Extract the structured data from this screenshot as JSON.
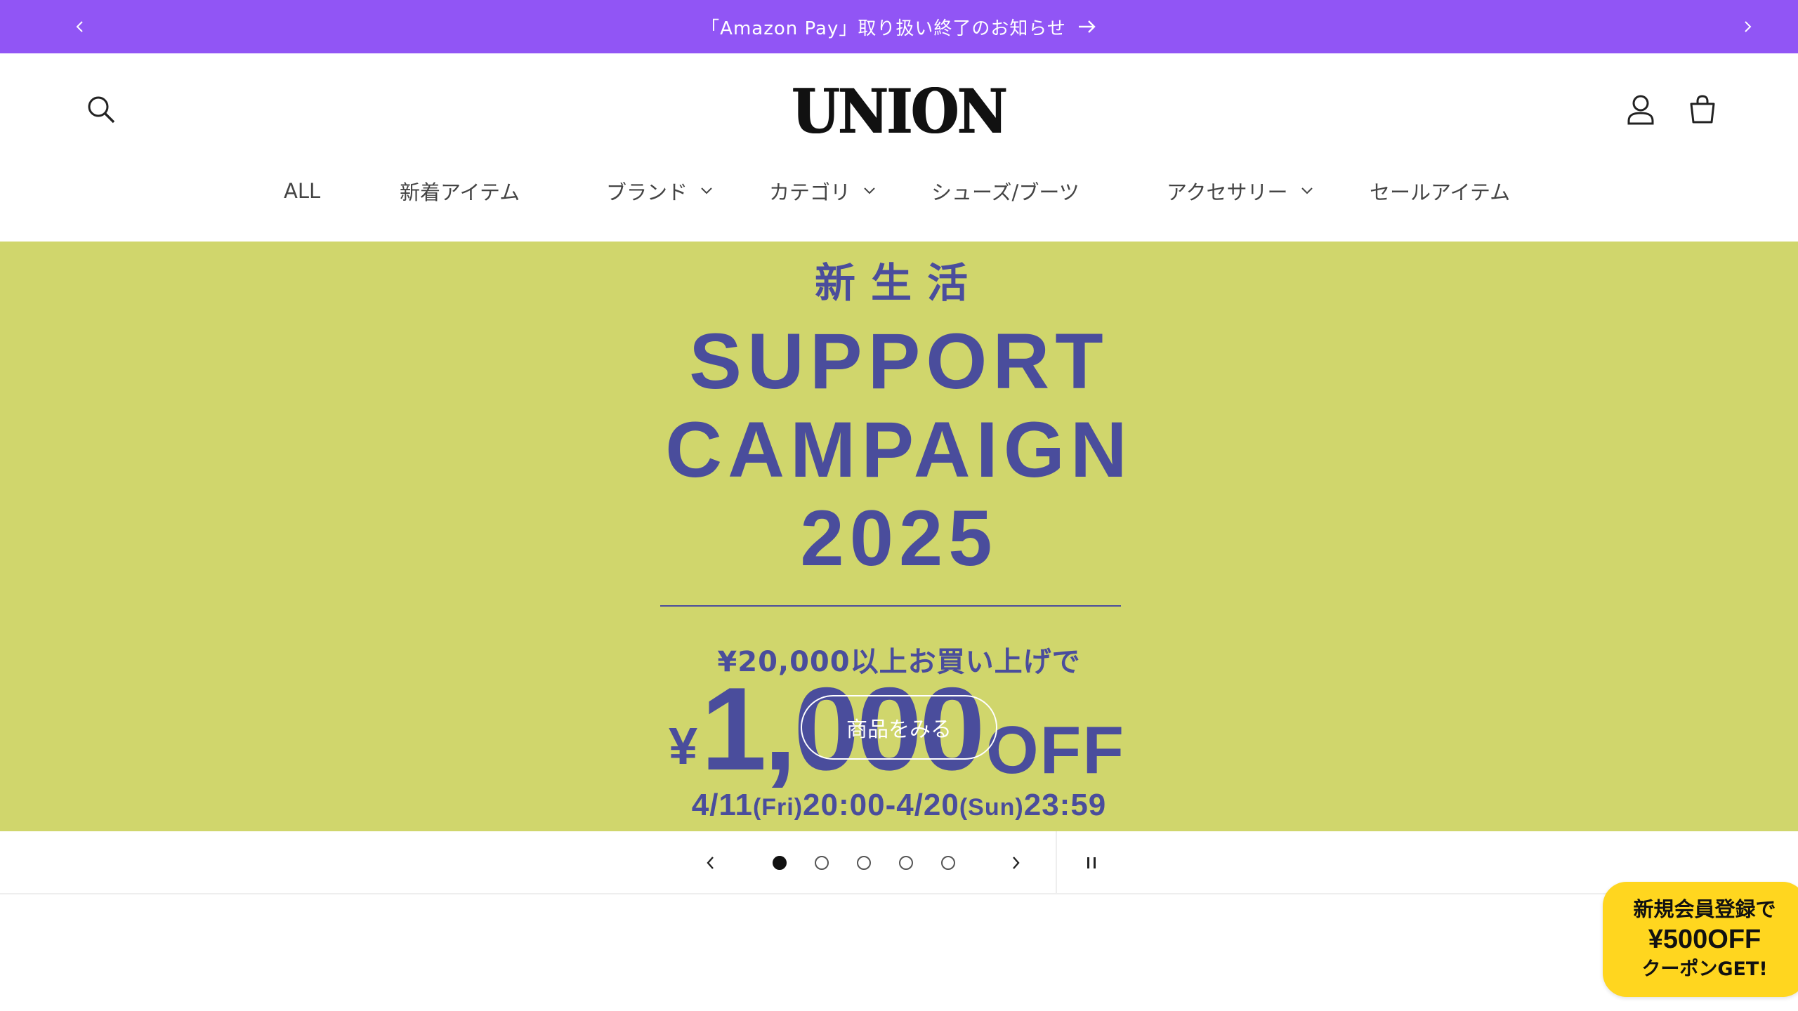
{
  "announcement": {
    "message": "「Amazon Pay」取り扱い終了のお知らせ"
  },
  "header": {
    "logo": "UNION"
  },
  "nav": {
    "items": [
      {
        "label": "ALL",
        "has_dropdown": false
      },
      {
        "label": "新着アイテム",
        "has_dropdown": false
      },
      {
        "label": "ブランド",
        "has_dropdown": true
      },
      {
        "label": "カテゴリ",
        "has_dropdown": true
      },
      {
        "label": "シューズ/ブーツ",
        "has_dropdown": false
      },
      {
        "label": "アクセサリー",
        "has_dropdown": true
      },
      {
        "label": "セールアイテム",
        "has_dropdown": false
      }
    ]
  },
  "hero": {
    "kanji": "新生活",
    "line1": "SUPPORT",
    "line2": "CAMPAIGN",
    "line3": "2025",
    "condition": "¥20,000以上お買い上げで",
    "price_currency": "¥",
    "price_amount": "1,000",
    "price_suffix": "OFF",
    "period_start": "4/11",
    "period_start_day": "(Fri)",
    "period_start_time": "20:00-4/20",
    "period_end_day": "(Sun)",
    "period_end_time": "23:59",
    "cta": "商品をみる",
    "background": "#d0d66c",
    "text_color": "#4a4d9c"
  },
  "slider": {
    "slide_count": 5,
    "active_index": 0
  },
  "coupon": {
    "line1": "新規会員登録で",
    "line2": "¥500OFF",
    "line3": "クーポンGET!",
    "color": "#ffd61f"
  },
  "colors": {
    "announcement_bg": "#9155f5"
  }
}
